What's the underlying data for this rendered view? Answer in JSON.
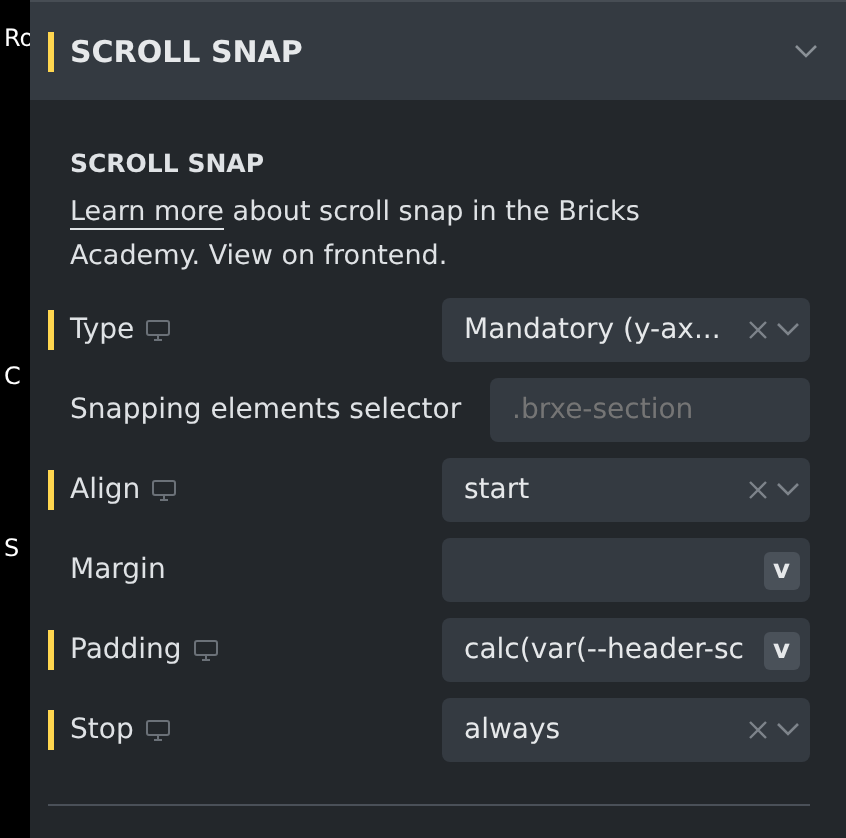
{
  "background_fragments": [
    "Ro",
    "C",
    "S"
  ],
  "section": {
    "title": "SCROLL SNAP",
    "marked": true,
    "expanded": true
  },
  "content": {
    "heading": "SCROLL SNAP",
    "link": "Learn more",
    "description": " about scroll snap in the Bricks Academy. View on frontend."
  },
  "controls": [
    {
      "label": "Type",
      "marked": true,
      "responsive": true,
      "kind": "select",
      "value": "Mandatory (y-ax..."
    },
    {
      "label": "Snapping elements selector",
      "marked": false,
      "responsive": false,
      "kind": "text",
      "placeholder": ".brxe-section"
    },
    {
      "label": "Align",
      "marked": true,
      "responsive": true,
      "kind": "select",
      "value": "start"
    },
    {
      "label": "Margin",
      "marked": false,
      "responsive": false,
      "kind": "unit",
      "unit": "v"
    },
    {
      "label": "Padding",
      "marked": true,
      "responsive": true,
      "kind": "unit",
      "value": "calc(var(--header-sc",
      "unit": "v"
    },
    {
      "label": "Stop",
      "marked": true,
      "responsive": true,
      "kind": "select",
      "value": "always"
    }
  ]
}
